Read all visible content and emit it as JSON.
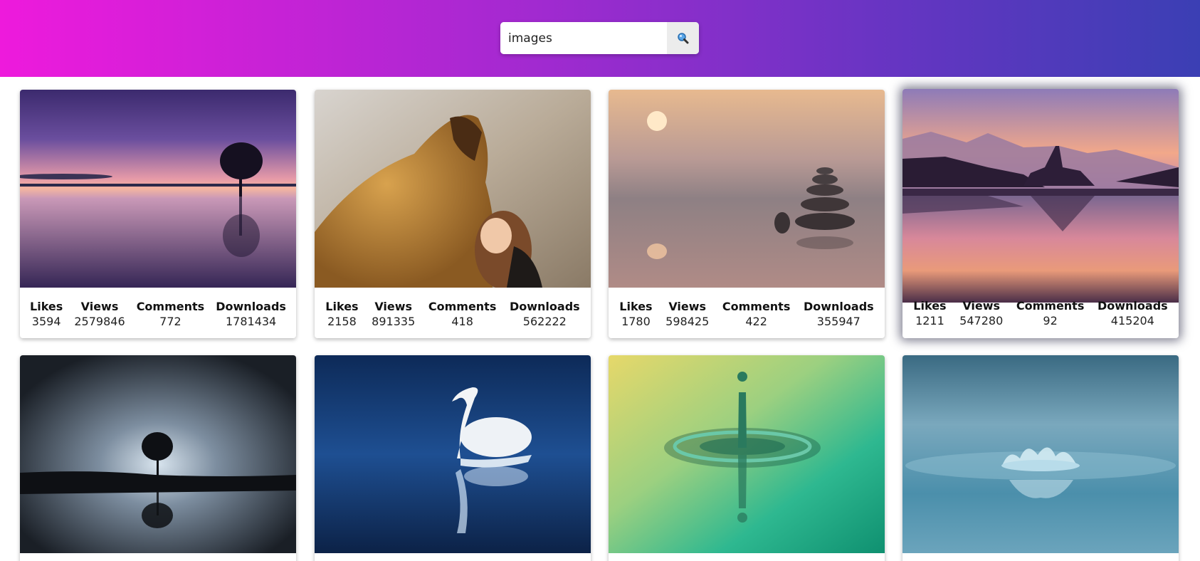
{
  "search": {
    "value": "images",
    "button_icon": "search-icon"
  },
  "stat_labels": {
    "likes": "Likes",
    "views": "Views",
    "comments": "Comments",
    "downloads": "Downloads"
  },
  "cards": [
    {
      "likes": "3594",
      "views": "2579846",
      "comments": "772",
      "downloads": "1781434",
      "scene": "sunset-lake-tree"
    },
    {
      "likes": "2158",
      "views": "891335",
      "comments": "418",
      "downloads": "562222",
      "scene": "lion-and-girl"
    },
    {
      "likes": "1780",
      "views": "598425",
      "comments": "422",
      "downloads": "355947",
      "scene": "stacked-stones-sunset"
    },
    {
      "likes": "1211",
      "views": "547280",
      "comments": "92",
      "downloads": "415204",
      "scene": "lake-castle-sunset"
    },
    {
      "scene": "night-tree-reflection"
    },
    {
      "scene": "white-swan-blue-water"
    },
    {
      "scene": "water-drop-green"
    },
    {
      "scene": "water-splash-blue"
    }
  ],
  "colors": {
    "header_start": "#ee1adc",
    "header_end": "#3b3fb4",
    "search_button_bg": "#ececec"
  }
}
